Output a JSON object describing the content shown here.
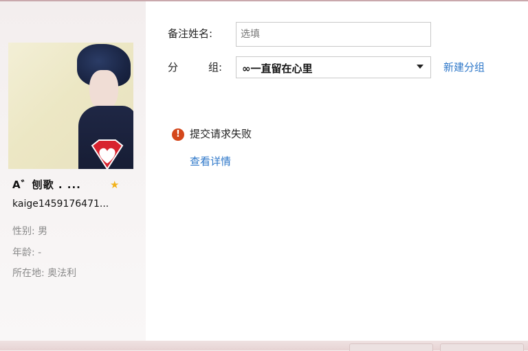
{
  "profile": {
    "nickname": "A゛刨歌 . ...",
    "account": "kaige1459176471...",
    "gender": "性别: 男",
    "age": "年龄: -",
    "location": "所在地: 奥法利"
  },
  "form": {
    "remark_label": "备注姓名:",
    "remark_placeholder": "选填",
    "group_label_1": "分",
    "group_label_2": "组:",
    "group_selected": "∞一直留在心里",
    "new_group_link": "新建分组"
  },
  "error": {
    "icon_glyph": "!",
    "message": "提交请求失败",
    "details_link": "查看详情"
  },
  "colors": {
    "link": "#2d77c9",
    "error": "#d4471b",
    "star": "#f2b21a"
  }
}
